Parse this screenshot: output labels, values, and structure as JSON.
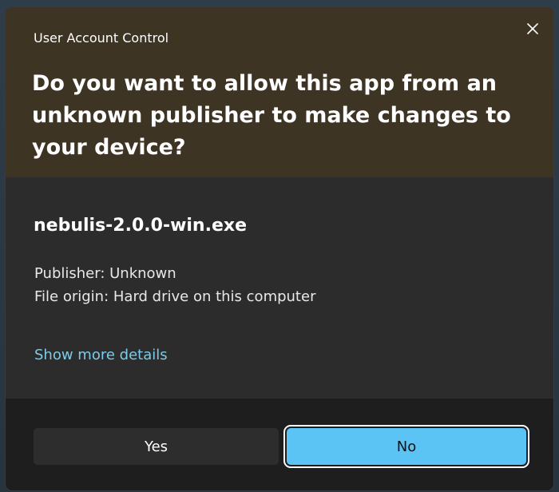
{
  "dialog": {
    "caption": "User Account Control",
    "headline": "Do you want to allow this app from an unknown publisher to make changes to your device?",
    "app_name": "nebulis-2.0.0-win.exe",
    "publisher": "Publisher: Unknown",
    "file_origin": "File origin: Hard drive on this computer",
    "details_link": "Show more details",
    "yes_label": "Yes",
    "no_label": "No",
    "close_icon": "close-icon"
  },
  "colors": {
    "header_bg": "#3e3424",
    "body_bg": "#2c2c2c",
    "footer_bg": "#1e1e1e",
    "link": "#7ccbe8",
    "primary_button": "#5cc3f5"
  }
}
